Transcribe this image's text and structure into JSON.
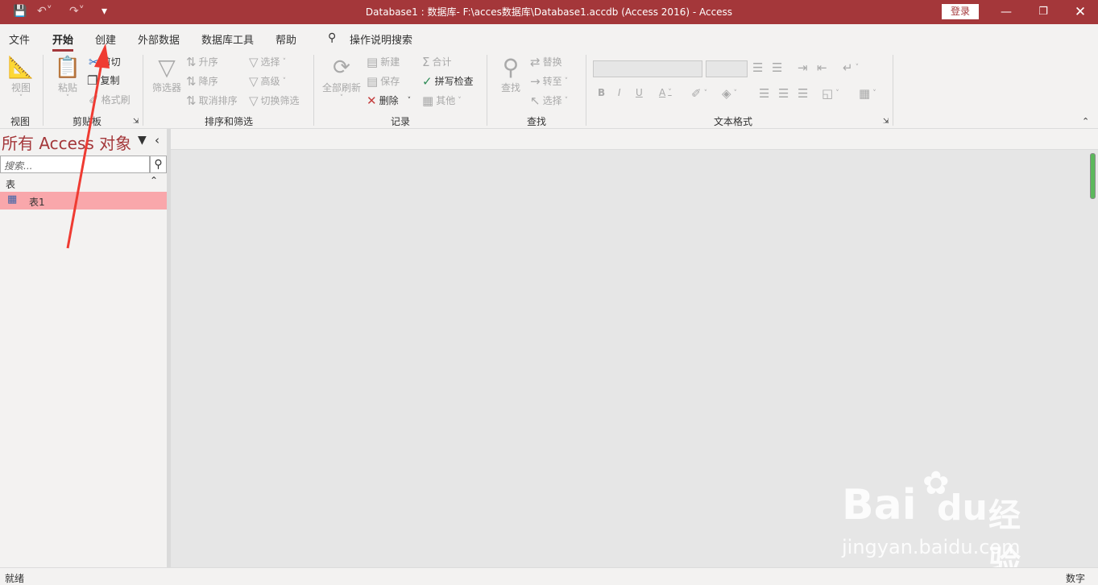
{
  "titlebar": {
    "title": "Database1 : 数据库- F:\\acces数据库\\Database1.accdb (Access 2016)  -  Access",
    "signin": "登录",
    "bg": "#a4373a"
  },
  "tabs": [
    "文件",
    "开始",
    "创建",
    "外部数据",
    "数据库工具",
    "帮助"
  ],
  "tellme": "操作说明搜索",
  "ribbon": {
    "view": {
      "label": "视图",
      "group": "视图"
    },
    "clipboard": {
      "paste": "粘贴",
      "cut": "剪切",
      "copy": "复制",
      "format_painter": "格式刷",
      "group": "剪贴板"
    },
    "sort": {
      "filter": "筛选器",
      "asc": "升序",
      "desc": "降序",
      "clear": "取消排序",
      "select": "选择",
      "advanced": "高级",
      "toggle": "切换筛选",
      "group": "排序和筛选"
    },
    "records": {
      "refresh": "全部刷新",
      "new": "新建",
      "save": "保存",
      "delete": "删除",
      "totals": "合计",
      "spelling": "拼写检查",
      "more": "其他",
      "group": "记录"
    },
    "find": {
      "find": "查找",
      "replace": "替换",
      "goto": "转至",
      "select": "选择",
      "group": "查找"
    },
    "text": {
      "group": "文本格式",
      "bold": "B",
      "italic": "I",
      "underline": "U",
      "font_color": "A"
    }
  },
  "nav": {
    "title": "所有 Access 对象",
    "search_placeholder": "搜索...",
    "section": "表",
    "items": [
      {
        "name": "表1"
      }
    ]
  },
  "status": {
    "left": "就绪",
    "right": "数字"
  },
  "watermark": {
    "brand_left": "Bai",
    "brand_right": "du",
    "brand_cn": "经验",
    "url": "jingyan.baidu.com"
  }
}
